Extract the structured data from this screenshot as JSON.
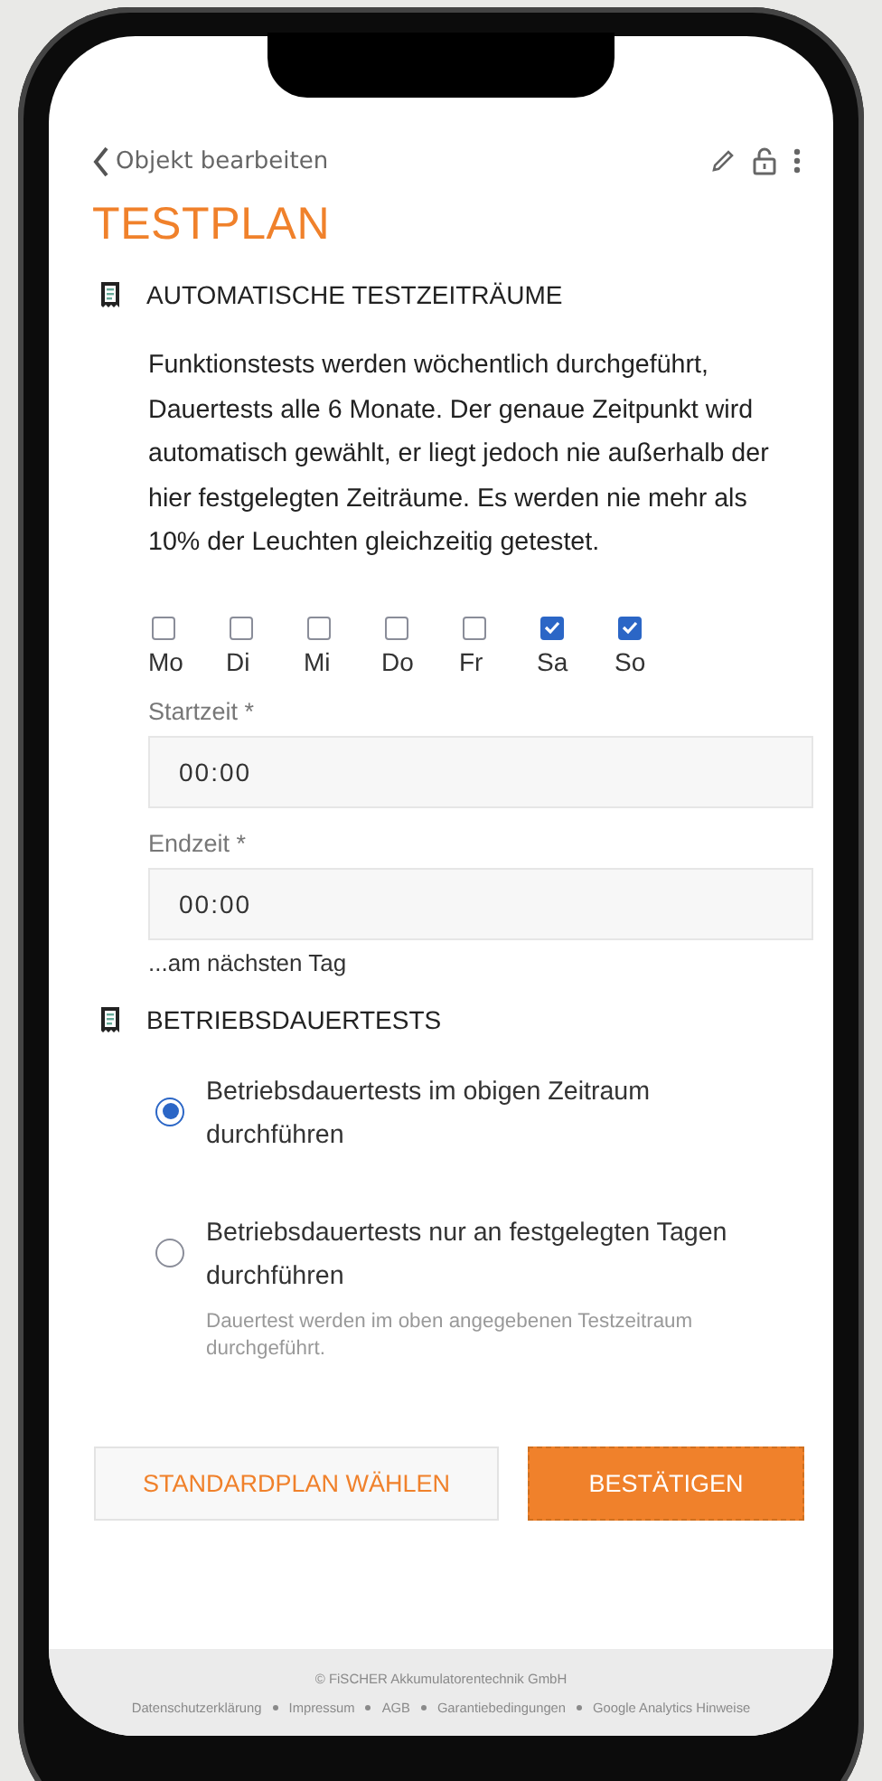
{
  "header": {
    "back_label": "Objekt bearbeiten"
  },
  "title": "TESTPLAN",
  "schedule": {
    "heading": "AUTOMATISCHE TESTZEITRÄUME",
    "description": "Funktionstests werden wöchentlich durchgeführt, Dauertests alle 6 Monate. Der genaue Zeitpunkt wird automatisch gewählt, er liegt jedoch nie außerhalb der hier festgelegten Zeiträume. Es werden nie mehr als 10% der Leuchten gleichzeitig getestet.",
    "days": [
      {
        "label": "Mo",
        "checked": false
      },
      {
        "label": "Di",
        "checked": false
      },
      {
        "label": "Mi",
        "checked": false
      },
      {
        "label": "Do",
        "checked": false
      },
      {
        "label": "Fr",
        "checked": false
      },
      {
        "label": "Sa",
        "checked": true
      },
      {
        "label": "So",
        "checked": true
      }
    ],
    "fields": [
      {
        "label": "Startzeit *",
        "value": "00:00"
      },
      {
        "label": "Endzeit *",
        "value": "00:00"
      }
    ],
    "note": "...am nächsten Tag"
  },
  "operating_tests": {
    "heading": "BETRIEBSDAUERTESTS",
    "options": [
      {
        "label": "Betriebsdauertests im obigen Zeitraum durchführen",
        "selected": true
      },
      {
        "label": "Betriebsdauertests nur an festgelegten Tagen durchführen",
        "selected": false,
        "hint": "Dauertest werden im oben angegebenen Testzeitraum durchgeführt."
      }
    ]
  },
  "buttons": [
    {
      "label": "STANDARDPLAN WÄHLEN",
      "kind": "secondary"
    },
    {
      "label": "BESTÄTIGEN",
      "kind": "primary"
    }
  ],
  "footer": {
    "copyright": "© FiSCHER Akkumulatorentechnik GmbH",
    "links": [
      "Datenschutzerklärung",
      "Impressum",
      "AGB",
      "Garantiebedingungen",
      "Google Analytics Hinweise"
    ]
  }
}
